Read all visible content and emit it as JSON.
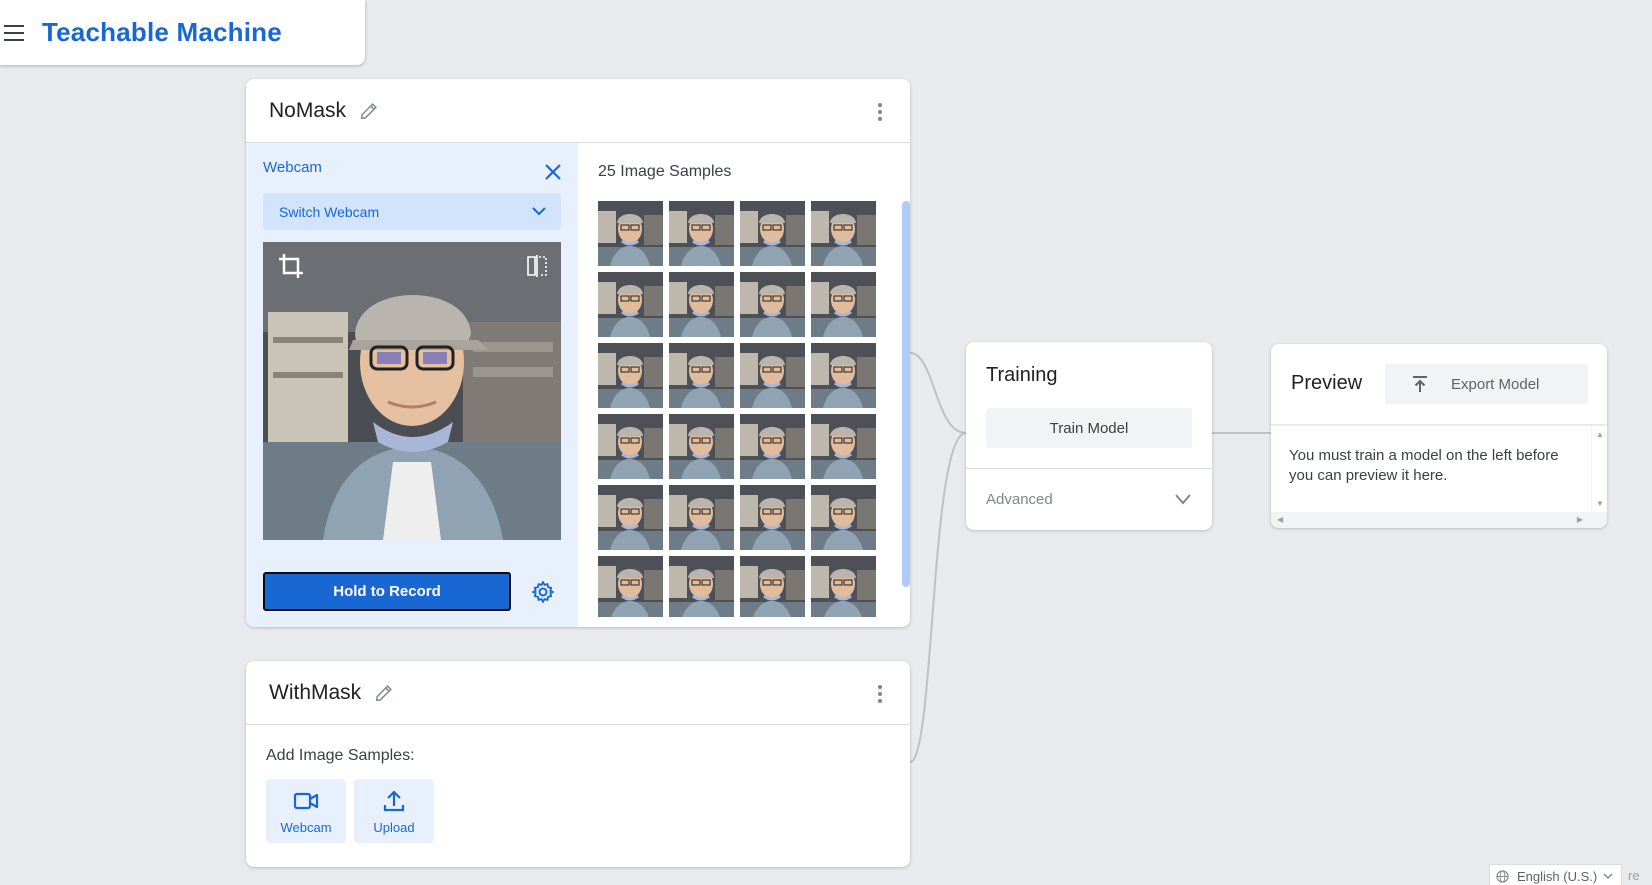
{
  "app": {
    "title": "Teachable Machine"
  },
  "classes": [
    {
      "name": "NoMask",
      "webcam_label": "Webcam",
      "switch_webcam_label": "Switch Webcam",
      "record_label": "Hold to Record",
      "samples_title": "25 Image Samples",
      "sample_count": 24
    },
    {
      "name": "WithMask",
      "add_samples_label": "Add Image Samples:",
      "webcam_button_label": "Webcam",
      "upload_button_label": "Upload"
    }
  ],
  "training": {
    "title": "Training",
    "train_button_label": "Train Model",
    "advanced_label": "Advanced"
  },
  "preview": {
    "title": "Preview",
    "export_button_label": "Export Model",
    "message": "You must train a model on the left before you can preview it here."
  },
  "footer": {
    "language": "English (U.S.)",
    "corner_text": "re"
  },
  "colors": {
    "accent": "#1967d2",
    "panel_bg": "#e8f0fe",
    "page_bg": "#e8eaed"
  }
}
